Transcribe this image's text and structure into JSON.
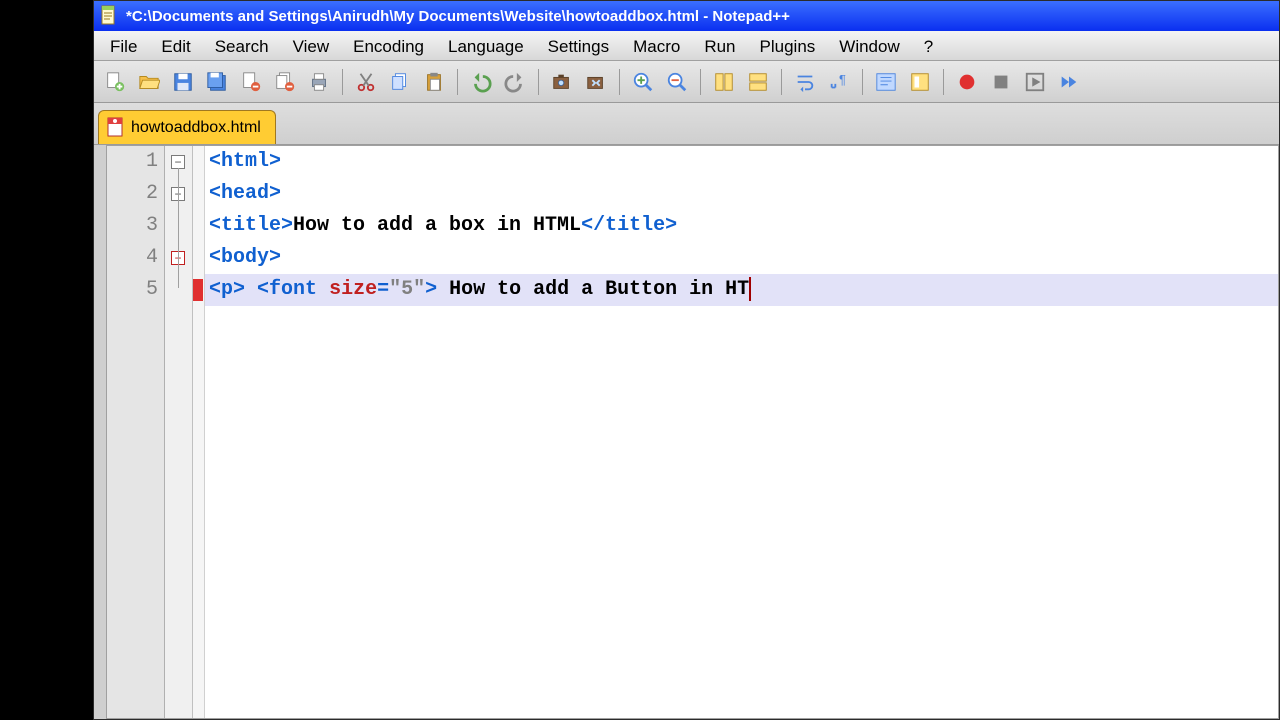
{
  "titlebar": {
    "text": "*C:\\Documents and Settings\\Anirudh\\My Documents\\Website\\howtoaddbox.html - Notepad++"
  },
  "menu": {
    "items": [
      "File",
      "Edit",
      "Search",
      "View",
      "Encoding",
      "Language",
      "Settings",
      "Macro",
      "Run",
      "Plugins",
      "Window",
      "?"
    ]
  },
  "toolbar_icons": [
    "new-file-icon",
    "open-file-icon",
    "save-icon",
    "save-all-icon",
    "close-icon",
    "close-all-icon",
    "print-icon",
    "sep",
    "cut-icon",
    "copy-icon",
    "paste-icon",
    "sep",
    "undo-icon",
    "redo-icon",
    "sep",
    "find-icon",
    "replace-icon",
    "sep",
    "zoom-in-icon",
    "zoom-out-icon",
    "sep",
    "sync-v-icon",
    "sync-h-icon",
    "sep",
    "wrap-icon",
    "whitespace-icon",
    "sep",
    "indent-guide-icon",
    "doc-map-icon",
    "sep",
    "record-macro-icon",
    "stop-macro-icon",
    "play-macro-icon",
    "fast-macro-icon"
  ],
  "tabs": {
    "active": "howtoaddbox.html"
  },
  "code": {
    "lines": [
      {
        "num": "1",
        "parts": [
          {
            "c": "tk-tag",
            "t": "<html>"
          }
        ],
        "fold": "open"
      },
      {
        "num": "2",
        "parts": [
          {
            "c": "tk-tag",
            "t": "<head>"
          }
        ],
        "fold": "open"
      },
      {
        "num": "3",
        "parts": [
          {
            "c": "tk-tag",
            "t": "<title>"
          },
          {
            "c": "tk-txt",
            "t": "How to add a box in HTML"
          },
          {
            "c": "tk-tag",
            "t": "</title>"
          }
        ]
      },
      {
        "num": "4",
        "parts": [
          {
            "c": "tk-tag",
            "t": "<body>"
          }
        ],
        "fold": "open-red"
      },
      {
        "num": "5",
        "hl": true,
        "caret": true,
        "parts": [
          {
            "c": "tk-tag",
            "t": "<p>"
          },
          {
            "c": "",
            "t": " "
          },
          {
            "c": "tk-tag",
            "t": "<font"
          },
          {
            "c": "",
            "t": " "
          },
          {
            "c": "tk-attr",
            "t": "size"
          },
          {
            "c": "tk-tag",
            "t": "="
          },
          {
            "c": "tk-str",
            "t": "\"5\""
          },
          {
            "c": "tk-tag",
            "t": ">"
          },
          {
            "c": "tk-txt",
            "t": " How to add a Button in HT"
          }
        ],
        "bookmark": true
      }
    ]
  }
}
